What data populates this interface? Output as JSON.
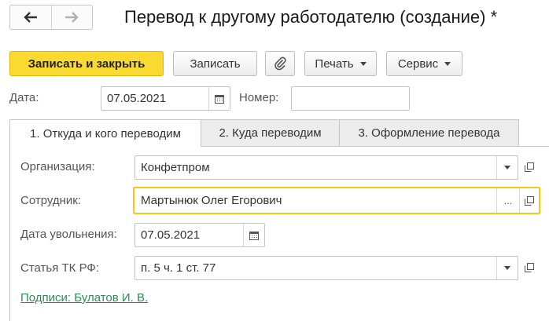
{
  "window": {
    "title": "Перевод к другому работодателю (создание) *"
  },
  "nav": {
    "back_icon": "arrow-left-icon",
    "forward_icon": "arrow-right-icon"
  },
  "toolbar": {
    "save_close_label": "Записать и закрыть",
    "save_label": "Записать",
    "attach_icon": "paperclip-icon",
    "print_label": "Печать",
    "service_label": "Сервис"
  },
  "header": {
    "date_label": "Дата:",
    "date_value": "07.05.2021",
    "number_label": "Номер:",
    "number_value": ""
  },
  "tabs": [
    {
      "label": "1. Откуда и кого переводим",
      "active": true
    },
    {
      "label": "2. Куда переводим",
      "active": false
    },
    {
      "label": "3. Оформление перевода",
      "active": false
    }
  ],
  "form": {
    "organization_label": "Организация:",
    "organization_value": "Конфетпром",
    "employee_label": "Сотрудник:",
    "employee_value": "Мартынюк Олег Егорович",
    "employee_select_label": "...",
    "dismissal_date_label": "Дата увольнения:",
    "dismissal_date_value": "07.05.2021",
    "article_label": "Статья ТК РФ:",
    "article_value": "п. 5 ч. 1 ст. 77",
    "signatures_link": "Подписи: Булатов И. В."
  },
  "colors": {
    "primary_button": "#fad930",
    "focus_border": "#f2c81b",
    "link": "#2e8b57"
  }
}
